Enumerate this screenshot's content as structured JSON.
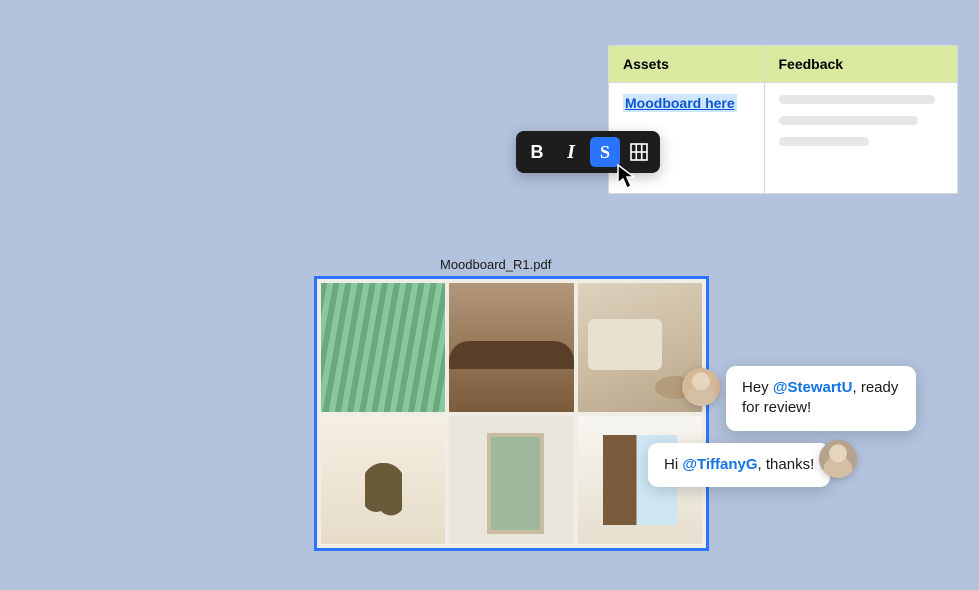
{
  "table": {
    "headers": {
      "col1": "Assets",
      "col2": "Feedback"
    },
    "row1": {
      "linkText": "Moodboard here"
    }
  },
  "toolbar": {
    "bold": "B",
    "italic": "I",
    "strike": "S"
  },
  "file": {
    "name": "Moodboard_R1.pdf"
  },
  "comments": {
    "c1": {
      "prefix": "Hey ",
      "mention": "@StewartU",
      "suffix": ", ready for review!"
    },
    "c2": {
      "prefix": "Hi ",
      "mention": "@TiffanyG",
      "suffix": ", thanks!"
    }
  }
}
